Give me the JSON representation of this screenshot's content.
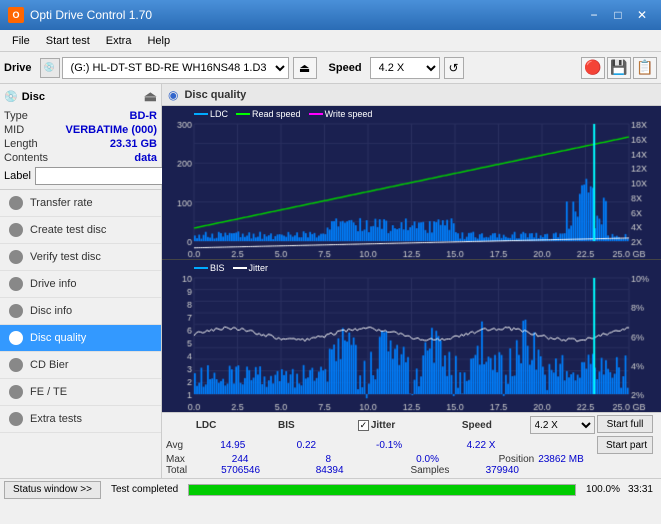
{
  "app": {
    "title": "Opti Drive Control 1.70",
    "icon": "O"
  },
  "titlebar": {
    "minimize": "−",
    "maximize": "□",
    "close": "✕"
  },
  "menubar": {
    "items": [
      "File",
      "Start test",
      "Extra",
      "Help"
    ]
  },
  "toolbar": {
    "drive_label": "Drive",
    "drive_value": "(G:) HL-DT-ST BD-RE  WH16NS48 1.D3",
    "speed_label": "Speed",
    "speed_value": "4.2 X"
  },
  "disc": {
    "header": "Disc",
    "type_label": "Type",
    "type_value": "BD-R",
    "mid_label": "MID",
    "mid_value": "VERBATIMe (000)",
    "length_label": "Length",
    "length_value": "23.31 GB",
    "contents_label": "Contents",
    "contents_value": "data",
    "label_label": "Label"
  },
  "nav": {
    "items": [
      {
        "id": "transfer-rate",
        "label": "Transfer rate",
        "active": false
      },
      {
        "id": "create-test-disc",
        "label": "Create test disc",
        "active": false
      },
      {
        "id": "verify-test-disc",
        "label": "Verify test disc",
        "active": false
      },
      {
        "id": "drive-info",
        "label": "Drive info",
        "active": false
      },
      {
        "id": "disc-info",
        "label": "Disc info",
        "active": false
      },
      {
        "id": "disc-quality",
        "label": "Disc quality",
        "active": true
      },
      {
        "id": "cd-bier",
        "label": "CD Bier",
        "active": false
      },
      {
        "id": "fe-te",
        "label": "FE / TE",
        "active": false
      },
      {
        "id": "extra-tests",
        "label": "Extra tests",
        "active": false
      }
    ]
  },
  "content": {
    "title": "Disc quality",
    "chart1": {
      "title": "Disc quality",
      "legend": [
        "LDC",
        "Read speed",
        "Write speed"
      ],
      "y_labels_left": [
        "300",
        "200",
        "100",
        "0"
      ],
      "y_labels_right": [
        "18X",
        "16X",
        "14X",
        "12X",
        "10X",
        "8X",
        "6X",
        "4X",
        "2X"
      ],
      "x_labels": [
        "0.0",
        "2.5",
        "5.0",
        "7.5",
        "10.0",
        "12.5",
        "15.0",
        "17.5",
        "20.0",
        "22.5",
        "25.0 GB"
      ]
    },
    "chart2": {
      "legend": [
        "BIS",
        "Jitter"
      ],
      "y_labels_left": [
        "10",
        "9",
        "8",
        "7",
        "6",
        "5",
        "4",
        "3",
        "2",
        "1"
      ],
      "y_labels_right": [
        "10%",
        "8%",
        "6%",
        "4%",
        "2%"
      ],
      "x_labels": [
        "0.0",
        "2.5",
        "5.0",
        "7.5",
        "10.0",
        "12.5",
        "15.0",
        "17.5",
        "20.0",
        "22.5",
        "25.0 GB"
      ]
    }
  },
  "stats": {
    "headers": [
      "LDC",
      "BIS",
      "Jitter",
      "Speed",
      ""
    ],
    "avg_label": "Avg",
    "avg_ldc": "14.95",
    "avg_bis": "0.22",
    "avg_jitter": "-0.1%",
    "avg_speed": "4.22 X",
    "max_label": "Max",
    "max_ldc": "244",
    "max_bis": "8",
    "max_jitter": "0.0%",
    "max_speed_label": "Position",
    "max_speed_value": "23862 MB",
    "total_label": "Total",
    "total_ldc": "5706546",
    "total_bis": "84394",
    "total_jitter_label": "Samples",
    "total_jitter_value": "379940",
    "jitter_checked": true,
    "speed_value": "4.2 X",
    "start_full": "Start full",
    "start_part": "Start part"
  },
  "statusbar": {
    "button": "Status window >>",
    "text": "Test completed",
    "progress": 100,
    "percent": "100.0%",
    "time": "33:31"
  }
}
